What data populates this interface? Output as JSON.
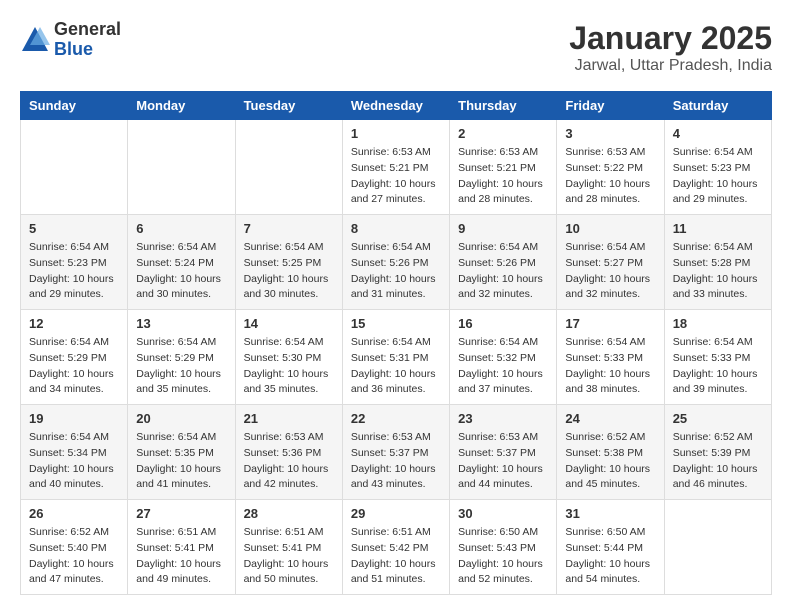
{
  "header": {
    "logo_general": "General",
    "logo_blue": "Blue",
    "month_title": "January 2025",
    "location": "Jarwal, Uttar Pradesh, India"
  },
  "weekdays": [
    "Sunday",
    "Monday",
    "Tuesday",
    "Wednesday",
    "Thursday",
    "Friday",
    "Saturday"
  ],
  "weeks": [
    [
      {
        "day": "",
        "info": ""
      },
      {
        "day": "",
        "info": ""
      },
      {
        "day": "",
        "info": ""
      },
      {
        "day": "1",
        "info": "Sunrise: 6:53 AM\nSunset: 5:21 PM\nDaylight: 10 hours\nand 27 minutes."
      },
      {
        "day": "2",
        "info": "Sunrise: 6:53 AM\nSunset: 5:21 PM\nDaylight: 10 hours\nand 28 minutes."
      },
      {
        "day": "3",
        "info": "Sunrise: 6:53 AM\nSunset: 5:22 PM\nDaylight: 10 hours\nand 28 minutes."
      },
      {
        "day": "4",
        "info": "Sunrise: 6:54 AM\nSunset: 5:23 PM\nDaylight: 10 hours\nand 29 minutes."
      }
    ],
    [
      {
        "day": "5",
        "info": "Sunrise: 6:54 AM\nSunset: 5:23 PM\nDaylight: 10 hours\nand 29 minutes."
      },
      {
        "day": "6",
        "info": "Sunrise: 6:54 AM\nSunset: 5:24 PM\nDaylight: 10 hours\nand 30 minutes."
      },
      {
        "day": "7",
        "info": "Sunrise: 6:54 AM\nSunset: 5:25 PM\nDaylight: 10 hours\nand 30 minutes."
      },
      {
        "day": "8",
        "info": "Sunrise: 6:54 AM\nSunset: 5:26 PM\nDaylight: 10 hours\nand 31 minutes."
      },
      {
        "day": "9",
        "info": "Sunrise: 6:54 AM\nSunset: 5:26 PM\nDaylight: 10 hours\nand 32 minutes."
      },
      {
        "day": "10",
        "info": "Sunrise: 6:54 AM\nSunset: 5:27 PM\nDaylight: 10 hours\nand 32 minutes."
      },
      {
        "day": "11",
        "info": "Sunrise: 6:54 AM\nSunset: 5:28 PM\nDaylight: 10 hours\nand 33 minutes."
      }
    ],
    [
      {
        "day": "12",
        "info": "Sunrise: 6:54 AM\nSunset: 5:29 PM\nDaylight: 10 hours\nand 34 minutes."
      },
      {
        "day": "13",
        "info": "Sunrise: 6:54 AM\nSunset: 5:29 PM\nDaylight: 10 hours\nand 35 minutes."
      },
      {
        "day": "14",
        "info": "Sunrise: 6:54 AM\nSunset: 5:30 PM\nDaylight: 10 hours\nand 35 minutes."
      },
      {
        "day": "15",
        "info": "Sunrise: 6:54 AM\nSunset: 5:31 PM\nDaylight: 10 hours\nand 36 minutes."
      },
      {
        "day": "16",
        "info": "Sunrise: 6:54 AM\nSunset: 5:32 PM\nDaylight: 10 hours\nand 37 minutes."
      },
      {
        "day": "17",
        "info": "Sunrise: 6:54 AM\nSunset: 5:33 PM\nDaylight: 10 hours\nand 38 minutes."
      },
      {
        "day": "18",
        "info": "Sunrise: 6:54 AM\nSunset: 5:33 PM\nDaylight: 10 hours\nand 39 minutes."
      }
    ],
    [
      {
        "day": "19",
        "info": "Sunrise: 6:54 AM\nSunset: 5:34 PM\nDaylight: 10 hours\nand 40 minutes."
      },
      {
        "day": "20",
        "info": "Sunrise: 6:54 AM\nSunset: 5:35 PM\nDaylight: 10 hours\nand 41 minutes."
      },
      {
        "day": "21",
        "info": "Sunrise: 6:53 AM\nSunset: 5:36 PM\nDaylight: 10 hours\nand 42 minutes."
      },
      {
        "day": "22",
        "info": "Sunrise: 6:53 AM\nSunset: 5:37 PM\nDaylight: 10 hours\nand 43 minutes."
      },
      {
        "day": "23",
        "info": "Sunrise: 6:53 AM\nSunset: 5:37 PM\nDaylight: 10 hours\nand 44 minutes."
      },
      {
        "day": "24",
        "info": "Sunrise: 6:52 AM\nSunset: 5:38 PM\nDaylight: 10 hours\nand 45 minutes."
      },
      {
        "day": "25",
        "info": "Sunrise: 6:52 AM\nSunset: 5:39 PM\nDaylight: 10 hours\nand 46 minutes."
      }
    ],
    [
      {
        "day": "26",
        "info": "Sunrise: 6:52 AM\nSunset: 5:40 PM\nDaylight: 10 hours\nand 47 minutes."
      },
      {
        "day": "27",
        "info": "Sunrise: 6:51 AM\nSunset: 5:41 PM\nDaylight: 10 hours\nand 49 minutes."
      },
      {
        "day": "28",
        "info": "Sunrise: 6:51 AM\nSunset: 5:41 PM\nDaylight: 10 hours\nand 50 minutes."
      },
      {
        "day": "29",
        "info": "Sunrise: 6:51 AM\nSunset: 5:42 PM\nDaylight: 10 hours\nand 51 minutes."
      },
      {
        "day": "30",
        "info": "Sunrise: 6:50 AM\nSunset: 5:43 PM\nDaylight: 10 hours\nand 52 minutes."
      },
      {
        "day": "31",
        "info": "Sunrise: 6:50 AM\nSunset: 5:44 PM\nDaylight: 10 hours\nand 54 minutes."
      },
      {
        "day": "",
        "info": ""
      }
    ]
  ]
}
